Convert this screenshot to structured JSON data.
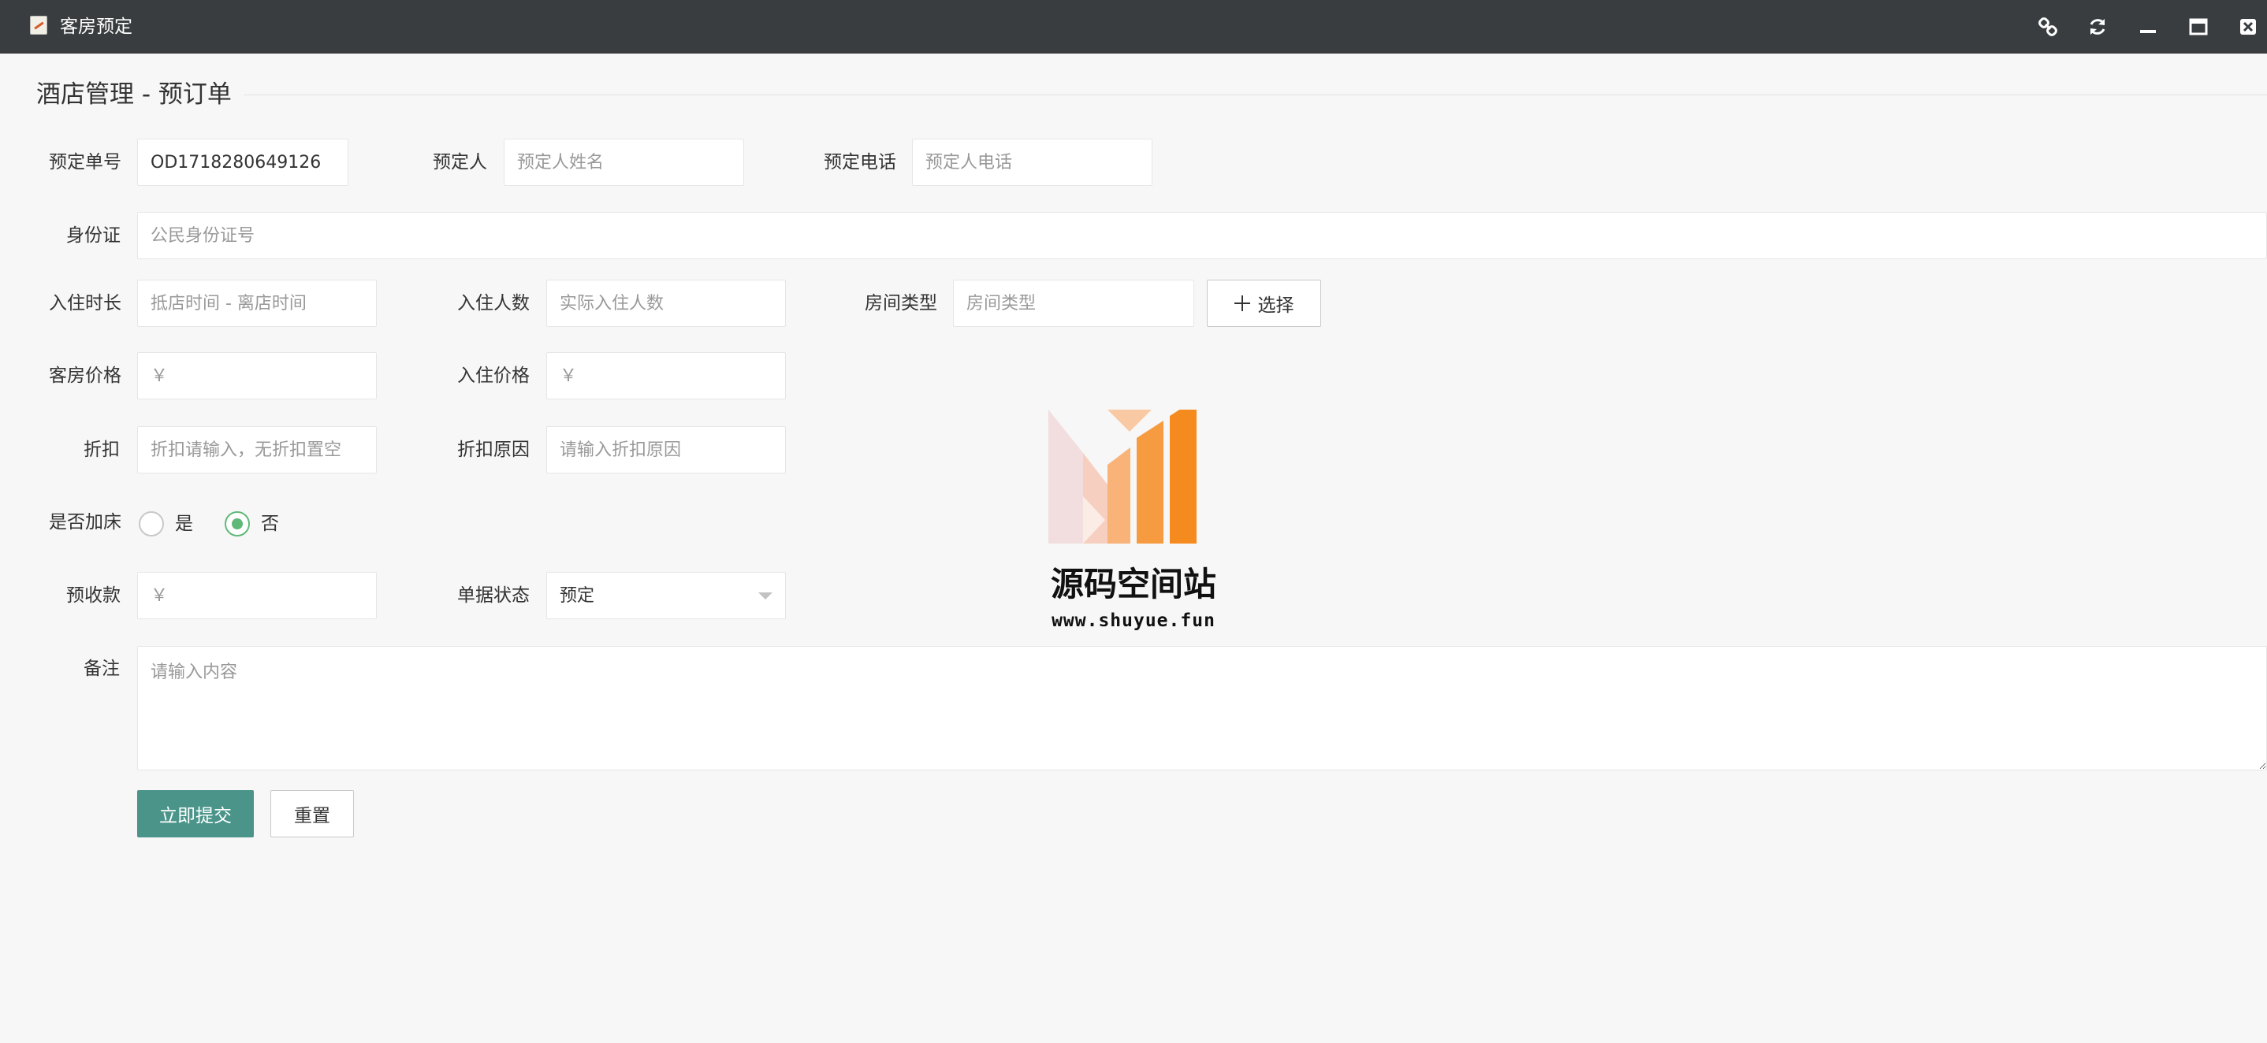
{
  "window": {
    "title": "客房预定",
    "icons": [
      "link-icon",
      "refresh-icon",
      "minimize-icon",
      "maximize-icon",
      "close-icon"
    ]
  },
  "legend": {
    "title": "酒店管理 - 预订单"
  },
  "form": {
    "order_no": {
      "label": "预定单号",
      "value": "OD1718280649126"
    },
    "booker": {
      "label": "预定人",
      "placeholder": "预定人姓名"
    },
    "phone": {
      "label": "预定电话",
      "placeholder": "预定人电话"
    },
    "id_card": {
      "label": "身份证",
      "placeholder": "公民身份证号"
    },
    "duration": {
      "label": "入住时长",
      "placeholder": "抵店时间 - 离店时间"
    },
    "guests": {
      "label": "入住人数",
      "placeholder": "实际入住人数"
    },
    "room_type": {
      "label": "房间类型",
      "placeholder": "房间类型",
      "choose_label": "选择"
    },
    "room_price": {
      "label": "客房价格",
      "placeholder": "￥"
    },
    "checkin_price": {
      "label": "入住价格",
      "placeholder": "￥"
    },
    "discount": {
      "label": "折扣",
      "placeholder": "折扣请输入，无折扣置空"
    },
    "discount_reason": {
      "label": "折扣原因",
      "placeholder": "请输入折扣原因"
    },
    "extra_bed": {
      "label": "是否加床",
      "options": [
        "是",
        "否"
      ],
      "selected": "否"
    },
    "deposit": {
      "label": "预收款",
      "placeholder": "￥"
    },
    "status": {
      "label": "单据状态",
      "value": "预定"
    },
    "remark": {
      "label": "备注",
      "placeholder": "请输入内容"
    },
    "submit_label": "立即提交",
    "reset_label": "重置"
  },
  "watermark": {
    "name": "源码空间站",
    "url": "www.shuyue.fun"
  },
  "colors": {
    "titlebar": "#393d40",
    "primary": "#4a948a",
    "radio_checked": "#5fb878",
    "logo_orange": "#f58a1f"
  }
}
